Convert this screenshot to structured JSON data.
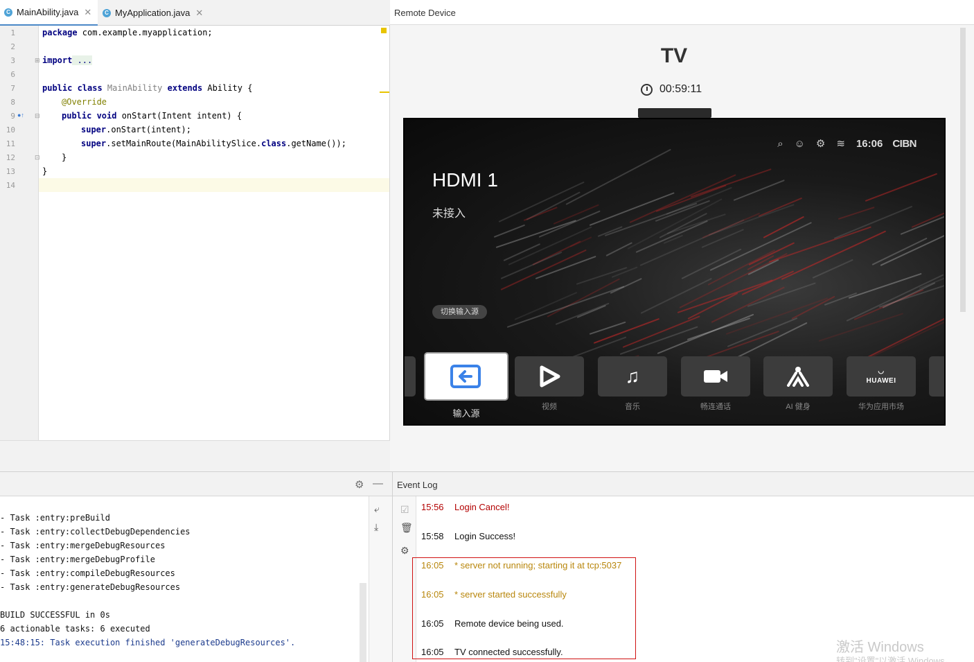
{
  "editor": {
    "tabs": [
      {
        "name": "MainAbility.java",
        "close": "✕",
        "icon": "C"
      },
      {
        "name": "MyApplication.java",
        "close": "✕",
        "icon": "C"
      }
    ],
    "lines": [
      {
        "n": "1"
      },
      {
        "n": "2"
      },
      {
        "n": "3"
      },
      {
        "n": "6"
      },
      {
        "n": "7"
      },
      {
        "n": "8"
      },
      {
        "n": "9"
      },
      {
        "n": "10"
      },
      {
        "n": "11"
      },
      {
        "n": "12"
      },
      {
        "n": "13"
      },
      {
        "n": "14"
      }
    ],
    "code": {
      "l1_kw": "package",
      "l1_rest": " com.example.myapplication;",
      "l3_kw": "import",
      "l3_fold": " ...",
      "l7_kw1": "public class",
      "l7_cls": " MainAbility",
      "l7_kw2": " extends",
      "l7_rest": " Ability {",
      "l8_ann": "@Override",
      "l9_kw": "public void",
      "l9_rest": " onStart(Intent intent) {",
      "l10_kw": "super",
      "l10_rest": ".onStart(intent);",
      "l11_kw": "super",
      "l11_mid": ".setMainRoute(MainAbilitySlice.",
      "l11_kw2": "class",
      "l11_rest": ".getName());",
      "l12": "}",
      "l13": "}"
    }
  },
  "remote": {
    "header": "Remote Device",
    "device_title": "TV",
    "timer": "00:59:11",
    "tv": {
      "time": "16:06",
      "brand": "CIBN",
      "input_title": "HDMI 1",
      "input_status": "未接入",
      "switch_label": "切换输入源",
      "apps": [
        {
          "label": "输入源"
        },
        {
          "label": "视频"
        },
        {
          "label": "音乐"
        },
        {
          "label": "畅连通话"
        },
        {
          "label": "AI 健身"
        },
        {
          "label": "华为应用市场",
          "logo": "HUAWEI"
        }
      ]
    }
  },
  "build": {
    "lines": [
      "- Task :entry:preBuild",
      "- Task :entry:collectDebugDependencies",
      "- Task :entry:mergeDebugResources",
      "- Task :entry:mergeDebugProfile",
      "- Task :entry:compileDebugResources",
      "- Task :entry:generateDebugResources",
      "",
      "BUILD SUCCESSFUL in 0s",
      "6 actionable tasks: 6 executed",
      "15:48:15: Task execution finished 'generateDebugResources'."
    ]
  },
  "eventlog": {
    "header": "Event Log",
    "entries": [
      {
        "time": "15:56",
        "text": "Login Cancel!"
      },
      {
        "time": "15:58",
        "text": "Login Success!"
      },
      {
        "time": "16:05",
        "text": "* server not running; starting it at tcp:5037"
      },
      {
        "time": "16:05",
        "text": "* server started successfully"
      },
      {
        "time": "16:05",
        "text": "Remote device being used."
      },
      {
        "time": "16:05",
        "text": "TV connected successfully."
      }
    ],
    "watermark": "激活 Windows",
    "watermark_sub": "转到\"设置\"以激活 Windows。"
  },
  "colors": {
    "accent": "#4a88c7",
    "error": "#b30000",
    "warning": "#b8860b",
    "highlight_box": "#d01010"
  }
}
